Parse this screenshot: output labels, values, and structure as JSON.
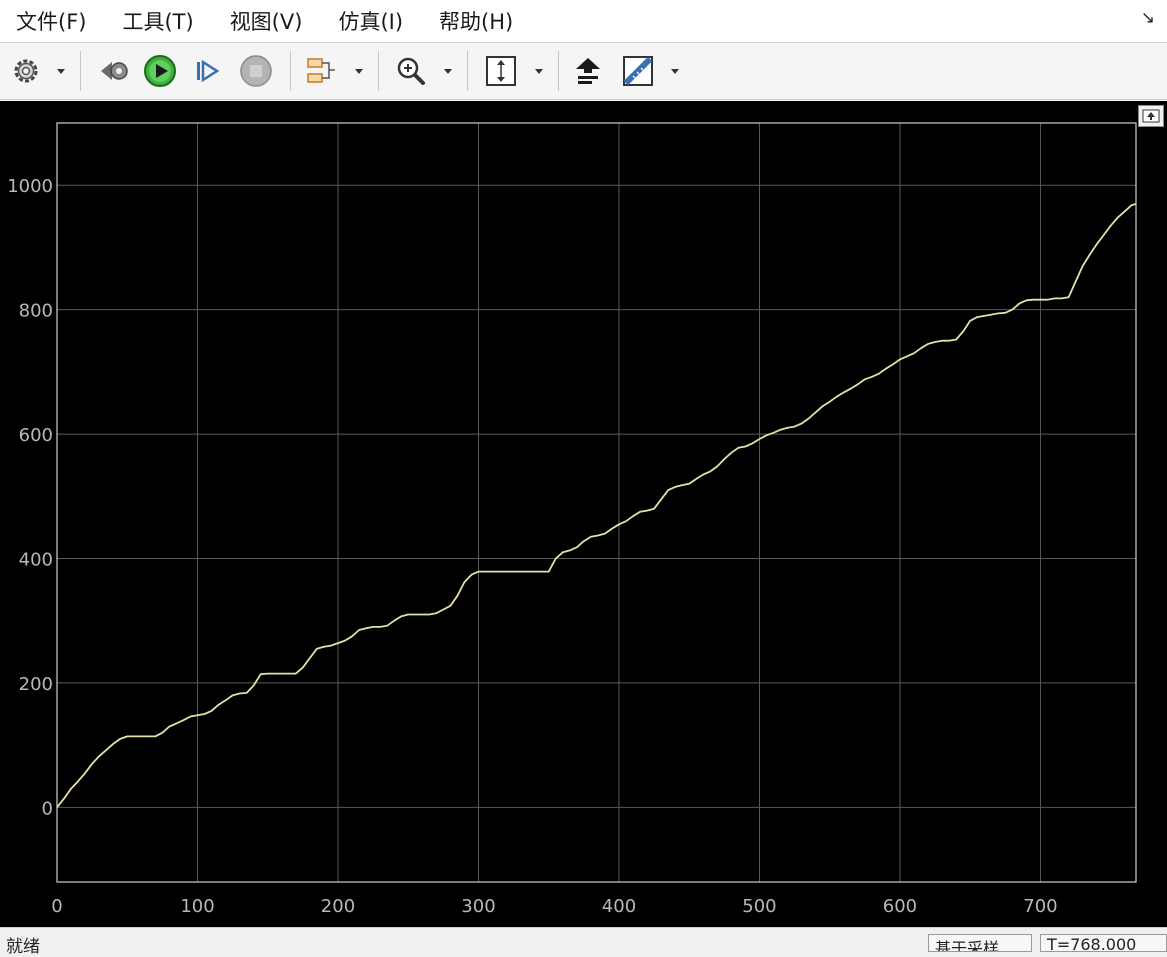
{
  "menu": {
    "items": [
      "文件(F)",
      "工具(T)",
      "视图(V)",
      "仿真(I)",
      "帮助(H)"
    ]
  },
  "window": {
    "undock_glyph": "↘"
  },
  "toolbar": {
    "icons": [
      "gear-icon",
      "step-back-icon",
      "run-icon",
      "step-forward-icon",
      "stop-icon",
      "highlight-block-icon",
      "zoom-icon",
      "autoscale-icon",
      "signal-select-icon",
      "measure-icon"
    ]
  },
  "status": {
    "text": "就绪",
    "mode": "基于采样",
    "time": "T=768.000"
  },
  "colors": {
    "plot_bg": "#000000",
    "grid": "#5a5a5a",
    "axis": "#cfcfcf",
    "tick_label": "#b8b8b8",
    "line": "#e6e0a8"
  },
  "chart_data": {
    "type": "line",
    "xlim": [
      0,
      768
    ],
    "ylim": [
      -120,
      1100
    ],
    "xticks": [
      0,
      100,
      200,
      300,
      400,
      500,
      600,
      700
    ],
    "yticks": [
      0,
      200,
      400,
      600,
      800,
      1000
    ],
    "grid": true,
    "series": [
      {
        "x": [
          0,
          5,
          10,
          15,
          20,
          25,
          30,
          35,
          40,
          45,
          50,
          55,
          60,
          65,
          70,
          75,
          80,
          85,
          90,
          95,
          100,
          105,
          110,
          115,
          120,
          125,
          130,
          135,
          140,
          145,
          150,
          155,
          160,
          165,
          170,
          175,
          180,
          185,
          190,
          195,
          200,
          205,
          210,
          215,
          220,
          225,
          230,
          235,
          240,
          245,
          250,
          255,
          260,
          265,
          270,
          275,
          280,
          285,
          290,
          295,
          300,
          310,
          320,
          330,
          340,
          350,
          355,
          360,
          365,
          370,
          375,
          380,
          385,
          390,
          395,
          400,
          405,
          410,
          415,
          420,
          425,
          430,
          435,
          440,
          445,
          450,
          455,
          460,
          465,
          470,
          475,
          480,
          485,
          490,
          495,
          500,
          505,
          510,
          515,
          520,
          525,
          530,
          535,
          540,
          545,
          550,
          555,
          560,
          565,
          570,
          575,
          580,
          585,
          590,
          595,
          600,
          605,
          610,
          615,
          620,
          625,
          630,
          635,
          640,
          645,
          650,
          655,
          660,
          665,
          670,
          675,
          680,
          685,
          690,
          695,
          700,
          705,
          710,
          715,
          720,
          725,
          730,
          735,
          740,
          745,
          750,
          755,
          760,
          765,
          768
        ],
        "y": [
          0,
          14,
          30,
          42,
          55,
          70,
          82,
          92,
          102,
          110,
          114,
          114,
          114,
          114,
          114,
          120,
          130,
          135,
          140,
          146,
          148,
          150,
          155,
          165,
          172,
          180,
          183,
          184,
          196,
          214,
          215,
          215,
          215,
          215,
          215,
          225,
          240,
          255,
          258,
          260,
          264,
          268,
          275,
          285,
          288,
          290,
          290,
          292,
          300,
          307,
          310,
          310,
          310,
          310,
          312,
          318,
          324,
          340,
          362,
          374,
          379,
          379,
          379,
          379,
          379,
          379,
          400,
          410,
          413,
          418,
          428,
          435,
          437,
          440,
          448,
          455,
          460,
          468,
          475,
          477,
          480,
          495,
          510,
          515,
          518,
          520,
          528,
          535,
          540,
          548,
          560,
          570,
          578,
          580,
          585,
          592,
          598,
          602,
          607,
          610,
          612,
          617,
          625,
          635,
          645,
          652,
          660,
          667,
          673,
          680,
          688,
          692,
          697,
          705,
          712,
          720,
          725,
          730,
          738,
          745,
          748,
          750,
          750,
          752,
          765,
          782,
          788,
          790,
          792,
          794,
          795,
          800,
          810,
          815,
          816,
          816,
          816,
          818,
          818,
          820,
          845,
          870,
          888,
          905,
          920,
          935,
          948,
          958,
          968,
          970
        ]
      }
    ]
  }
}
